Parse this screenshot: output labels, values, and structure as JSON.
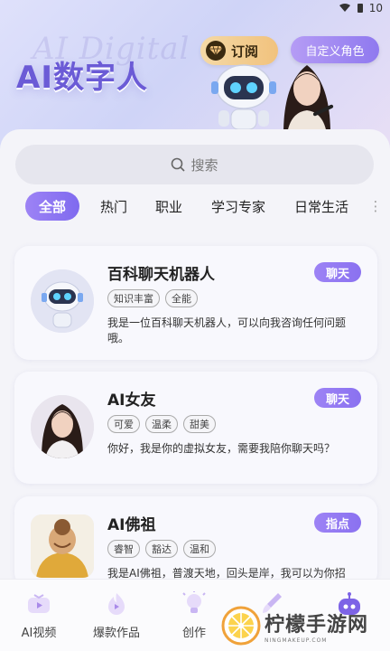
{
  "status_bar": {
    "time": "10"
  },
  "header": {
    "bg_text": "AI Digital",
    "title": "AI数字人",
    "subscribe_label": "订阅",
    "custom_role_label": "自定义角色"
  },
  "search": {
    "placeholder": "搜索"
  },
  "tabs": [
    {
      "label": "全部",
      "active": true
    },
    {
      "label": "热门",
      "active": false
    },
    {
      "label": "职业",
      "active": false
    },
    {
      "label": "学习专家",
      "active": false
    },
    {
      "label": "日常生活",
      "active": false
    }
  ],
  "cards": [
    {
      "name": "百科聊天机器人",
      "action": "聊天",
      "tags": [
        "知识丰富",
        "全能"
      ],
      "description": "我是一位百科聊天机器人，可以向我咨询任何问题哦。",
      "avatar_icon": "robot-icon"
    },
    {
      "name": "AI女友",
      "action": "聊天",
      "tags": [
        "可爱",
        "温柔",
        "甜美"
      ],
      "description": "你好，我是你的虚拟女友，需要我陪你聊天吗？",
      "avatar_icon": "woman-avatar-icon"
    },
    {
      "name": "AI佛祖",
      "action": "指点",
      "tags": [
        "睿智",
        "豁达",
        "温和"
      ],
      "description": "我是AI佛祖，普渡天地，回头是岸，我可以为你招",
      "avatar_icon": "buddha-icon"
    }
  ],
  "bottom_nav": [
    {
      "label": "AI视频",
      "icon": "video-icon"
    },
    {
      "label": "爆款作品",
      "icon": "flame-icon"
    },
    {
      "label": "创作",
      "icon": "lightbulb-icon"
    },
    {
      "label": "",
      "icon": "brush-icon"
    },
    {
      "label": "",
      "icon": "robot-head-icon"
    }
  ],
  "watermark": {
    "text": "柠檬手游网",
    "sub": "NINGMAKEUP.COM"
  },
  "colors": {
    "accent": "#8b74f0",
    "subscribe": "#f1c27d"
  }
}
